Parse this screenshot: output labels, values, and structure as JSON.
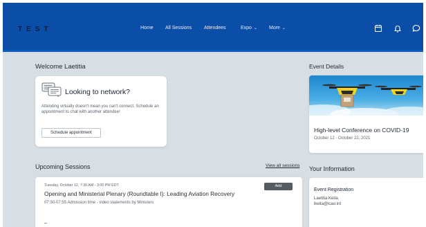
{
  "header": {
    "brand": "TEST",
    "nav": [
      {
        "label": "Home",
        "has_dropdown": false
      },
      {
        "label": "All Sessions",
        "has_dropdown": false
      },
      {
        "label": "Attendees",
        "has_dropdown": false
      },
      {
        "label": "Expo",
        "has_dropdown": true
      },
      {
        "label": "More",
        "has_dropdown": true
      }
    ],
    "icons": [
      "calendar-icon",
      "bell-icon",
      "chat-icon"
    ],
    "color": "#0a4ea8"
  },
  "welcome": {
    "title": "Welcome Laetitia",
    "network_card": {
      "title": "Looking to network?",
      "description": "Attending virtually doesn't mean you can't connect. Schedule an appointment to chat with another attendee!",
      "button_label": "Schedule appointment"
    }
  },
  "upcoming": {
    "title": "Upcoming Sessions",
    "view_all_label": "View all sessions",
    "sessions": [
      {
        "time": "Tuesday, October 12, 7:30 AM - 3:00 PM EDT",
        "title": "Opening and Ministerial Plenary (Roundtable I): Leading Aviation Recovery",
        "subtitle": "07:30-07:55 Admission time - video statements by Ministers",
        "add_label": "Add"
      }
    ]
  },
  "event_details": {
    "title": "Event Details",
    "event_name": "High-level Conference on COVID-19",
    "dates": "October 12 - October 22, 2021"
  },
  "your_information": {
    "title": "Your Information",
    "heading": "Event Registration",
    "name": "Laetitia Keita",
    "email": "lkeita@icao.int"
  }
}
